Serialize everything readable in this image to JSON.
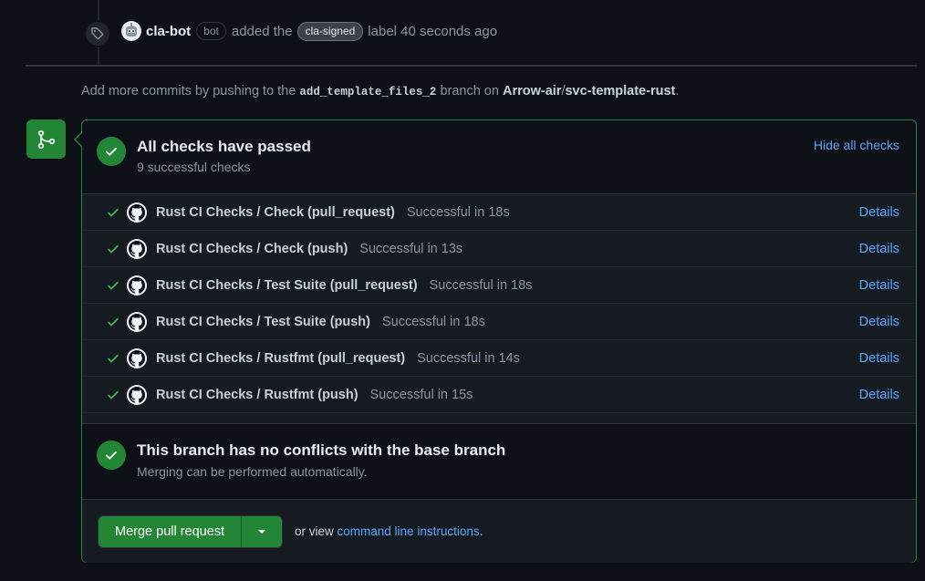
{
  "event": {
    "actor": "cla-bot",
    "bot_badge": "bot",
    "action": "added the",
    "label": "cla-signed",
    "suffix": "label 40 seconds ago"
  },
  "hint": {
    "prefix": "Add more commits by pushing to the",
    "branch": "add_template_files_2",
    "middle": "branch on",
    "repo_owner": "Arrow-air",
    "repo_name": "svc-template-rust",
    "end": "."
  },
  "checks_section": {
    "title": "All checks have passed",
    "subtitle": "9 successful checks",
    "toggle_label": "Hide all checks"
  },
  "checks": [
    {
      "name": "Rust CI Checks / Check (pull_request)",
      "status": "Successful in 18s",
      "details": "Details"
    },
    {
      "name": "Rust CI Checks / Check (push)",
      "status": "Successful in 13s",
      "details": "Details"
    },
    {
      "name": "Rust CI Checks / Test Suite (pull_request)",
      "status": "Successful in 18s",
      "details": "Details"
    },
    {
      "name": "Rust CI Checks / Test Suite (push)",
      "status": "Successful in 18s",
      "details": "Details"
    },
    {
      "name": "Rust CI Checks / Rustfmt (pull_request)",
      "status": "Successful in 14s",
      "details": "Details"
    },
    {
      "name": "Rust CI Checks / Rustfmt (push)",
      "status": "Successful in 15s",
      "details": "Details"
    }
  ],
  "conflicts_section": {
    "title": "This branch has no conflicts with the base branch",
    "subtitle": "Merging can be performed automatically."
  },
  "merge": {
    "button_label": "Merge pull request",
    "or_view": "or view",
    "cli_link": "command line instructions",
    "end": "."
  },
  "colors": {
    "success": "#238636",
    "link": "#58a6ff",
    "background": "#0d1117"
  }
}
